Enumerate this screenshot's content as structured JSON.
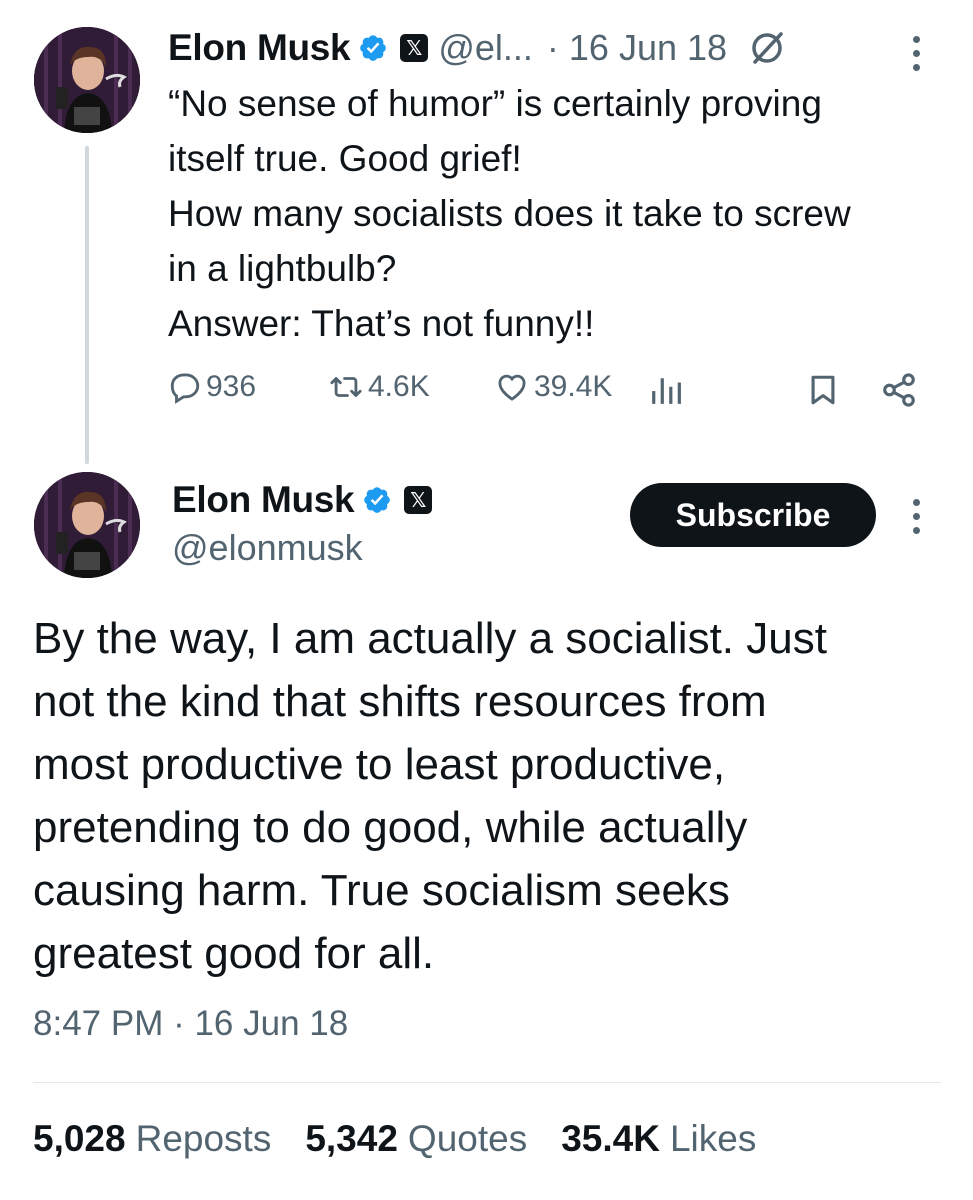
{
  "quoted_tweet": {
    "author_name": "Elon Musk",
    "handle": "@el...",
    "date": "· 16 Jun 18",
    "lines": [
      "“No sense of humor” is certainly proving",
      "itself true. Good grief!",
      "How many socialists does it take to screw",
      "in a lightbulb?",
      "Answer: That’s not funny!!"
    ],
    "replies": "936",
    "reposts": "4.6K",
    "likes": "39.4K"
  },
  "main_tweet": {
    "author_name": "Elon Musk",
    "handle": "@elonmusk",
    "subscribe_label": "Subscribe",
    "lines": [
      "By the way, I am actually a socialist. Just",
      "not the kind that shifts resources from",
      "most productive to least productive,",
      "pretending to do good, while actually",
      "causing harm. True socialism seeks",
      "greatest good for all."
    ],
    "timestamp": "8:47 PM · 16 Jun 18",
    "stats": {
      "reposts_count": "5,028",
      "reposts_label": "Reposts",
      "quotes_count": "5,342",
      "quotes_label": "Quotes",
      "likes_count": "35.4K",
      "likes_label": "Likes"
    }
  },
  "colors": {
    "verified_blue": "#1d9bf0",
    "secondary_text": "#536471",
    "primary_text": "#0f1419"
  },
  "icons": [
    "verified-icon",
    "x-badge-icon",
    "grok-icon",
    "more-icon",
    "reply-icon",
    "repost-icon",
    "like-icon",
    "views-icon",
    "bookmark-icon",
    "share-icon"
  ]
}
